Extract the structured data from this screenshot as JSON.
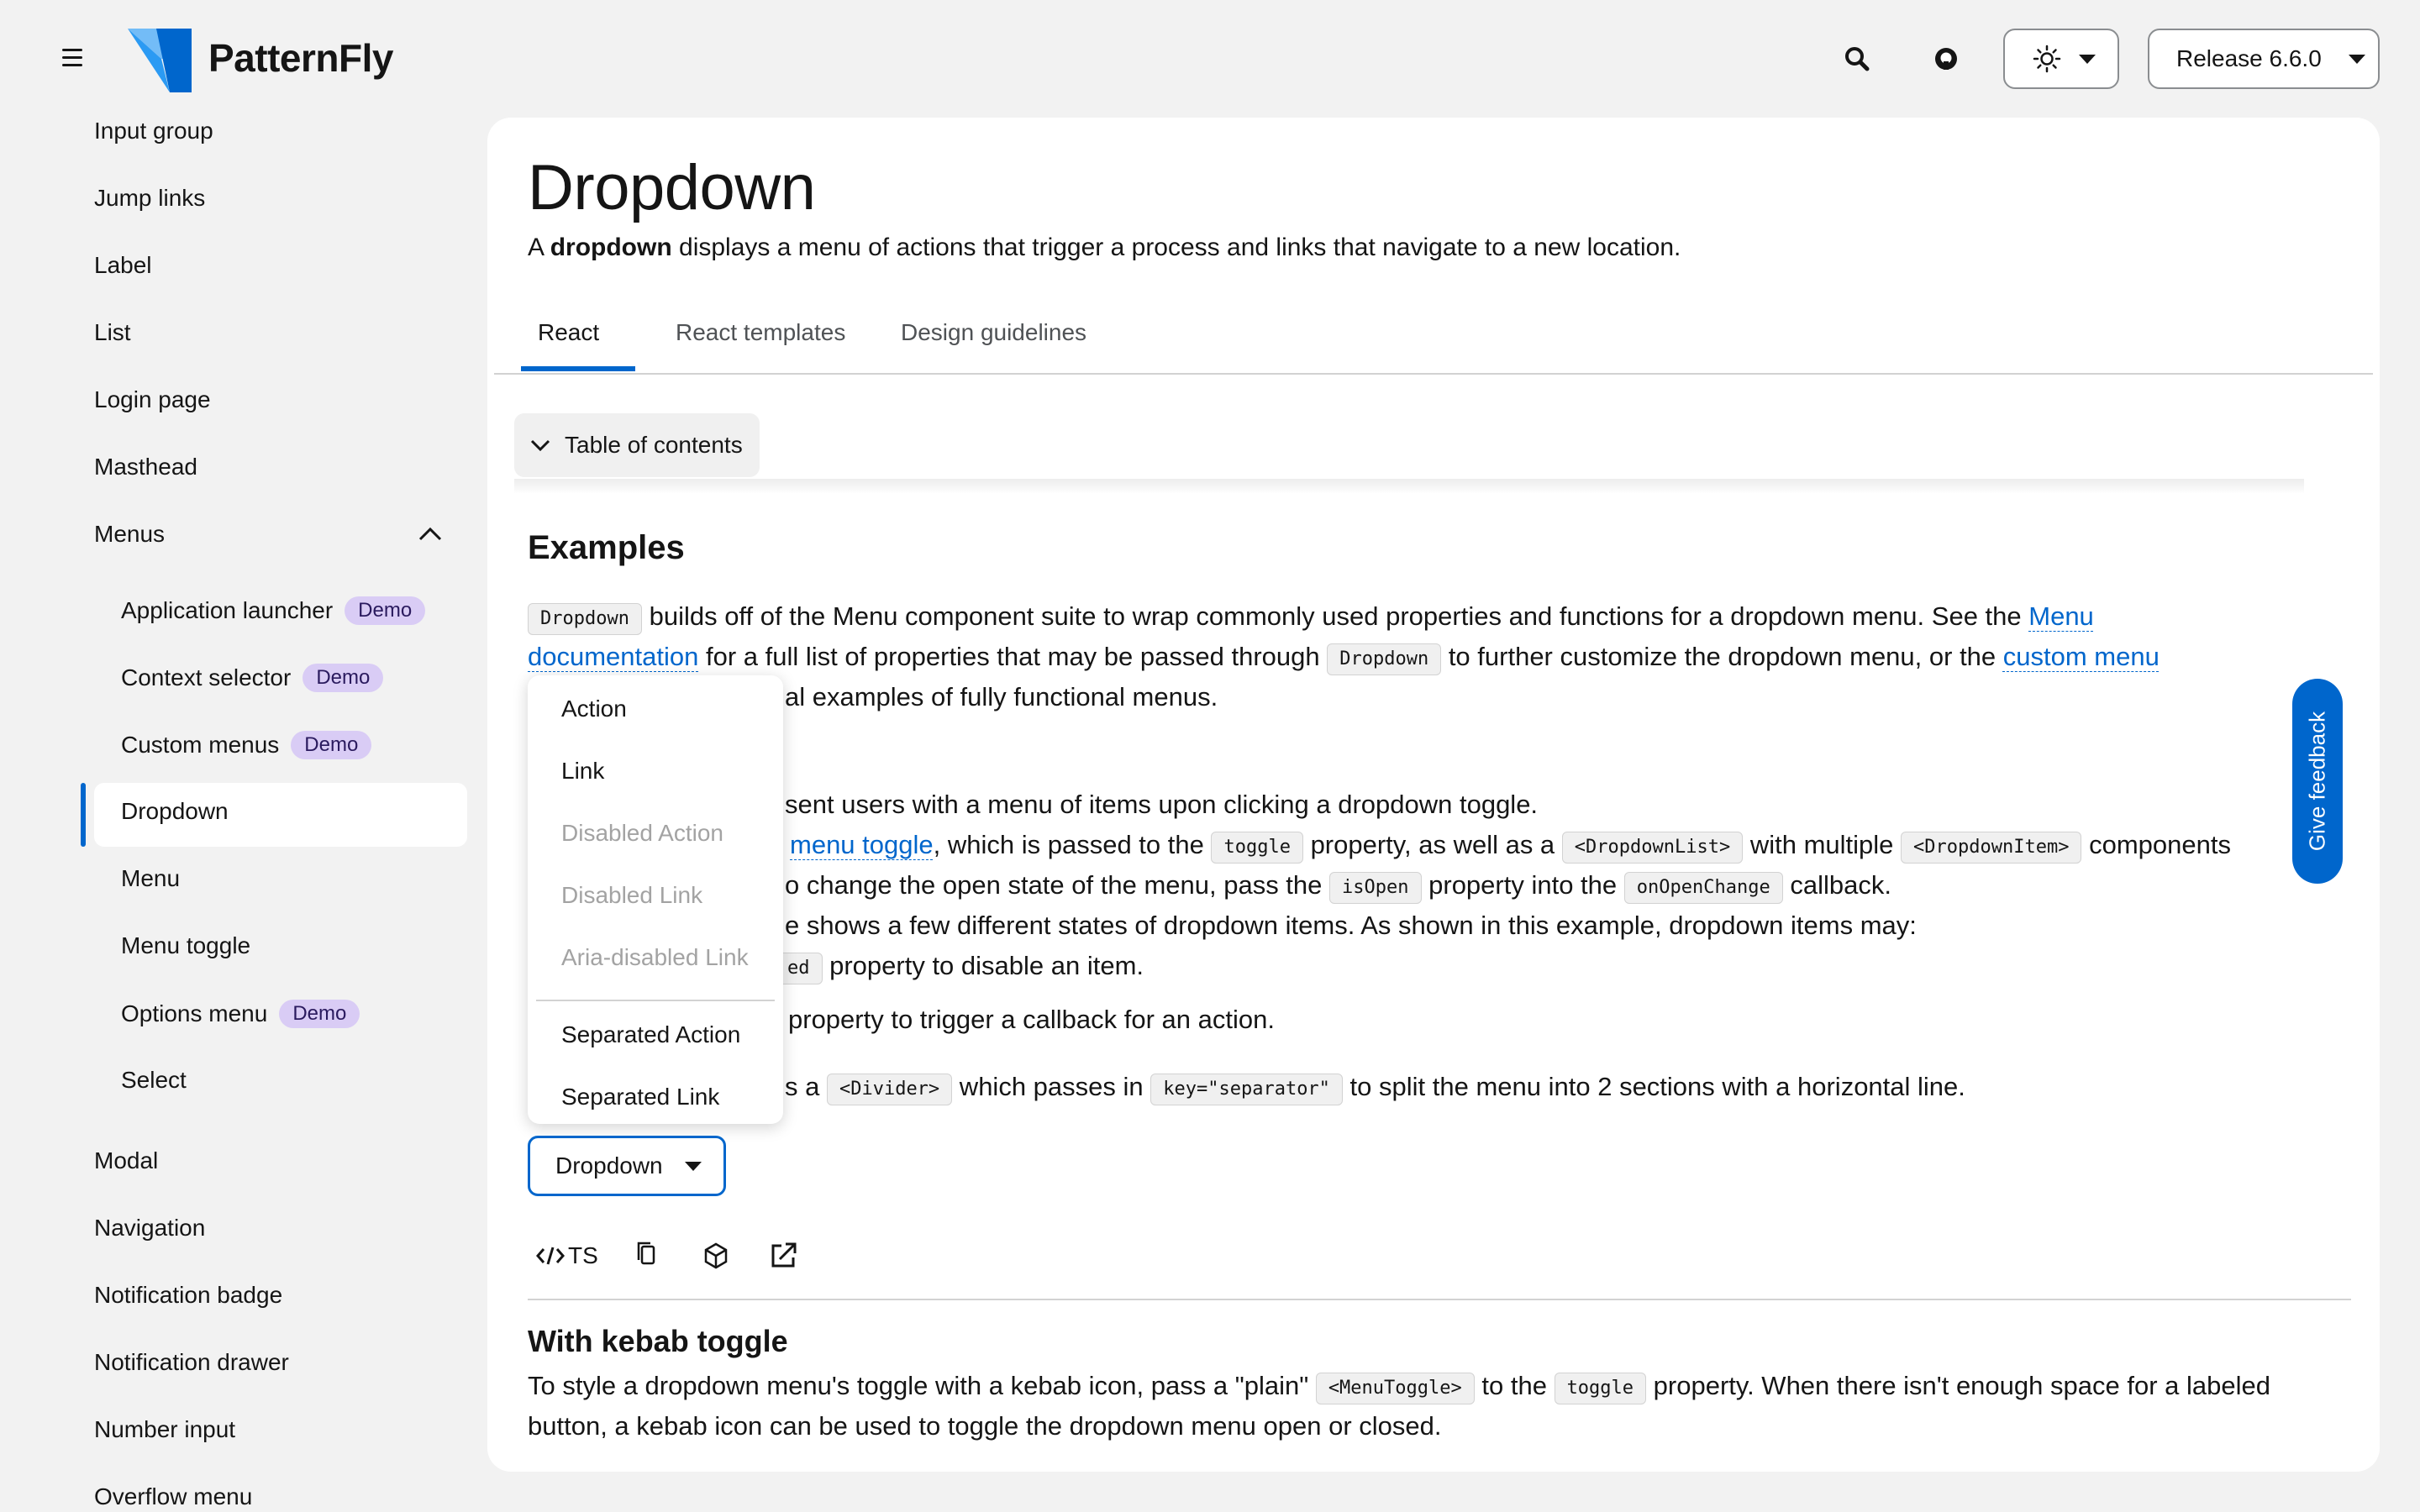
{
  "brand": {
    "name": "PatternFly"
  },
  "masthead": {
    "release_label": "Release 6.6.0",
    "icons": [
      "menu-icon",
      "search-icon",
      "github-icon",
      "sun-icon"
    ]
  },
  "sidebar": {
    "items": [
      {
        "label": "Input group",
        "level": 1
      },
      {
        "label": "Jump links",
        "level": 1
      },
      {
        "label": "Label",
        "level": 1
      },
      {
        "label": "List",
        "level": 1
      },
      {
        "label": "Login page",
        "level": 1
      },
      {
        "label": "Masthead",
        "level": 1
      },
      {
        "label": "Menus",
        "level": 1,
        "expanded": true
      },
      {
        "label": "Application launcher",
        "level": 2,
        "badge": "Demo"
      },
      {
        "label": "Context selector",
        "level": 2,
        "badge": "Demo"
      },
      {
        "label": "Custom menus",
        "level": 2,
        "badge": "Demo"
      },
      {
        "label": "Dropdown",
        "level": 2,
        "active": true
      },
      {
        "label": "Menu",
        "level": 2
      },
      {
        "label": "Menu toggle",
        "level": 2
      },
      {
        "label": "Options menu",
        "level": 2,
        "badge": "Demo"
      },
      {
        "label": "Select",
        "level": 2
      },
      {
        "label": "Modal",
        "level": 1
      },
      {
        "label": "Navigation",
        "level": 1
      },
      {
        "label": "Notification badge",
        "level": 1
      },
      {
        "label": "Notification drawer",
        "level": 1
      },
      {
        "label": "Number input",
        "level": 1
      },
      {
        "label": "Overflow menu",
        "level": 1
      }
    ]
  },
  "page": {
    "title": "Dropdown",
    "subtitle_pre": "A ",
    "subtitle_bold": "dropdown",
    "subtitle_post": " displays a menu of actions that trigger a process and links that navigate to a new location.",
    "tabs": [
      {
        "label": "React",
        "active": true
      },
      {
        "label": "React templates"
      },
      {
        "label": "Design guidelines"
      }
    ],
    "toc_label": "Table of contents",
    "examples_heading": "Examples"
  },
  "intro": {
    "code1": "Dropdown",
    "text1": " builds off of the Menu component suite to wrap commonly used properties and functions for a dropdown menu. See the ",
    "link1a": "Menu",
    "link1b": "documentation",
    "text2": " for a full list of properties that may be passed through ",
    "code2": "Dropdown",
    "text3": " to further customize the dropdown menu, or the ",
    "link2": "custom menu",
    "text4": "al examples of fully functional menus."
  },
  "basic": {
    "line1": "sent users with a menu of items upon clicking a dropdown toggle.",
    "line2_link": "menu toggle",
    "line2_a": ", which is passed to the ",
    "line2_code1": "toggle",
    "line2_b": " property, as well as a ",
    "line2_code2": "<DropdownList>",
    "line2_c": " with multiple ",
    "line2_code3": "<DropdownItem>",
    "line2_d": " components",
    "line3_a": "o change the open state of the menu, pass the ",
    "line3_code1": "isOpen",
    "line3_b": " property into the ",
    "line3_code2": "onOpenChange",
    "line3_c": " callback.",
    "line4": "e shows a few different states of dropdown items. As shown in this example, dropdown items may:",
    "line5_code": "ed",
    "line5_text": " property to disable an item.",
    "line6": "property to trigger a callback for an action.",
    "line7_a": "s a ",
    "line7_code1": "<Divider>",
    "line7_b": " which passes in ",
    "line7_code2": "key=\"separator\"",
    "line7_c": " to split the menu into 2 sections with a horizontal line."
  },
  "menu": {
    "items": [
      {
        "label": "Action",
        "disabled": false
      },
      {
        "label": "Link",
        "disabled": false
      },
      {
        "label": "Disabled Action",
        "disabled": true
      },
      {
        "label": "Disabled Link",
        "disabled": true
      },
      {
        "label": "Aria-disabled Link",
        "disabled": true
      },
      {
        "label": "Separated Action",
        "disabled": false
      },
      {
        "label": "Separated Link",
        "disabled": false
      }
    ]
  },
  "toggle": {
    "label": "Dropdown"
  },
  "code_toolbar": {
    "ts_label": "TS"
  },
  "kebab": {
    "heading": "With kebab toggle",
    "line1_a": "To style a dropdown menu's toggle with a kebab icon, pass a \"plain\" ",
    "line1_code1": "<MenuToggle>",
    "line1_b": " to the ",
    "line1_code2": "toggle",
    "line1_c": " property. When there isn't enough space for a labeled",
    "line2": "button, a kebab icon can be used to toggle the dropdown menu open or closed."
  },
  "feedback": {
    "label": "Give feedback"
  },
  "colors": {
    "accent": "#0066cc",
    "badge_bg": "#d9ccf5",
    "page_bg": "#f2f2f2"
  }
}
